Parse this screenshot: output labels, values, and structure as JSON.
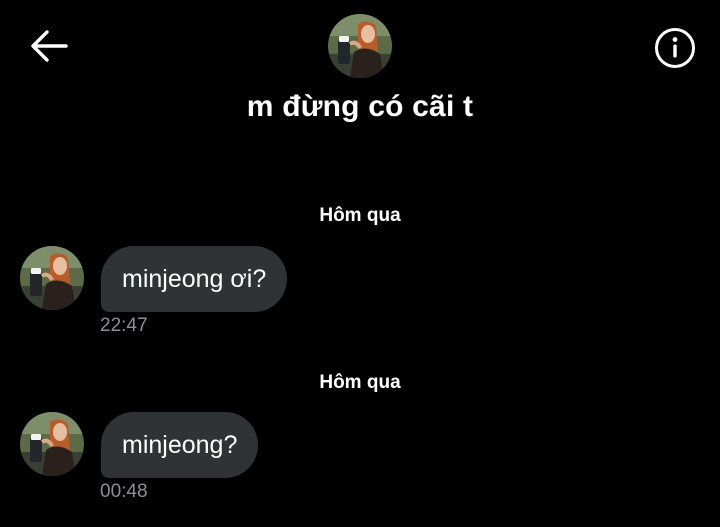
{
  "header": {
    "title": "m đừng có cãi t",
    "back_icon": "arrow-left-icon",
    "info_icon": "info-circle-icon"
  },
  "messages": [
    {
      "date_separator": "Hôm qua",
      "text": "minjeong ơi?",
      "time": "22:47"
    },
    {
      "date_separator": "Hôm qua",
      "text": "minjeong?",
      "time": "00:48"
    }
  ],
  "colors": {
    "background": "#000000",
    "bubble_incoming": "#2f3336",
    "timestamp": "#8b9096",
    "text": "#ffffff"
  }
}
